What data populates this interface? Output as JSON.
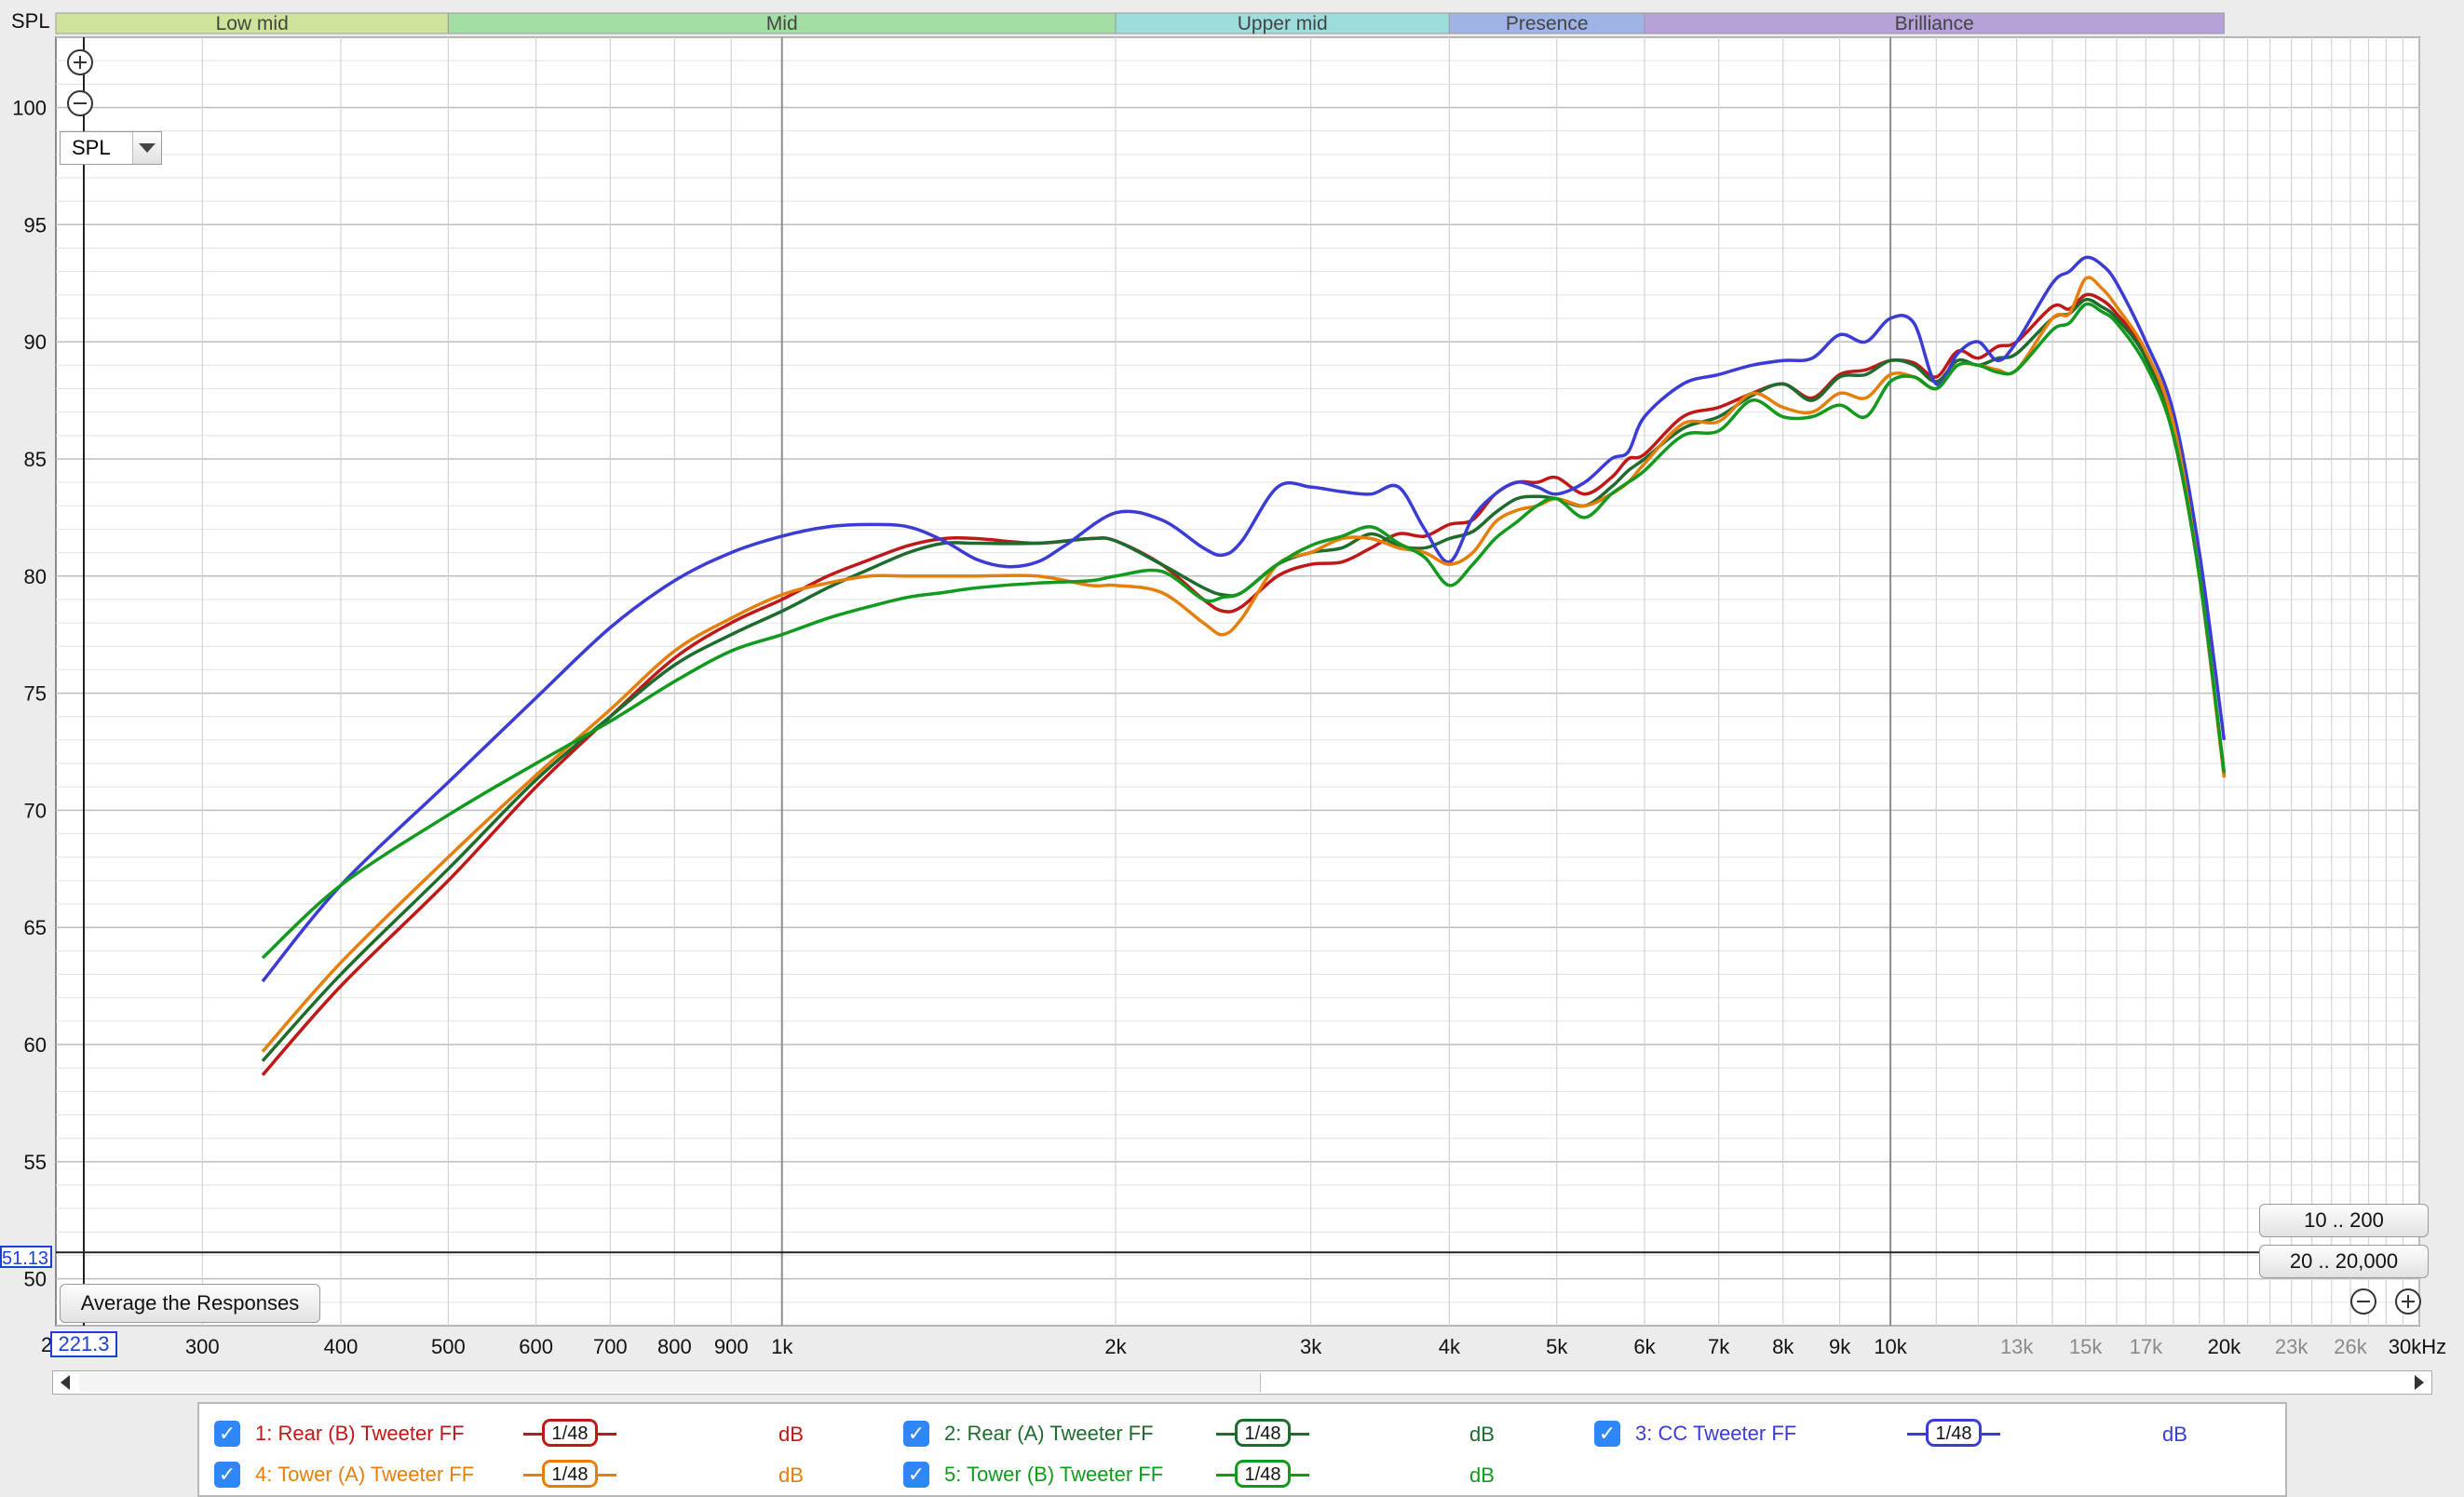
{
  "spl_title": "SPL",
  "unit_selector": "SPL",
  "y_cursor_value": "51.13",
  "x_cursor_value": "221.3",
  "x_axis_start": "2",
  "average_button": "Average the Responses",
  "range_buttons": [
    "10 .. 200",
    "20 .. 20,000"
  ],
  "bands": [
    {
      "label": "",
      "from": 20,
      "to": 100,
      "color": "#f7d08e"
    },
    {
      "label": "Low mid",
      "from": 100,
      "to": 500,
      "color": "#cfe39b"
    },
    {
      "label": "Mid",
      "from": 500,
      "to": 2000,
      "color": "#a3dea4"
    },
    {
      "label": "Upper mid",
      "from": 2000,
      "to": 4000,
      "color": "#9fdcdc"
    },
    {
      "label": "Presence",
      "from": 4000,
      "to": 6000,
      "color": "#9fb4e4"
    },
    {
      "label": "Brilliance",
      "from": 6000,
      "to": 20000,
      "color": "#b4a2d8"
    }
  ],
  "legend": [
    {
      "label": "1: Rear (B) Tweeter FF",
      "smoothing": "1/48",
      "unit": "dB",
      "color": "#c01818"
    },
    {
      "label": "2: Rear (A) Tweeter FF",
      "smoothing": "1/48",
      "unit": "dB",
      "color": "#1e6b2e"
    },
    {
      "label": "3: CC Tweeter FF",
      "smoothing": "1/48",
      "unit": "dB",
      "color": "#3b3bd6"
    },
    {
      "label": "4: Tower (A) Tweeter FF",
      "smoothing": "1/48",
      "unit": "dB",
      "color": "#e67e0c"
    },
    {
      "label": "5: Tower (B) Tweeter FF",
      "smoothing": "1/48",
      "unit": "dB",
      "color": "#119a1e"
    }
  ],
  "chart_data": {
    "type": "line",
    "xscale": "log",
    "xlabel": "Hz",
    "ylabel": "SPL",
    "xlim": [
      221.3,
      30000
    ],
    "ylim": [
      48,
      103
    ],
    "x_ticks": [
      {
        "v": 300,
        "label": "300"
      },
      {
        "v": 400,
        "label": "400"
      },
      {
        "v": 500,
        "label": "500"
      },
      {
        "v": 600,
        "label": "600"
      },
      {
        "v": 700,
        "label": "700"
      },
      {
        "v": 800,
        "label": "800"
      },
      {
        "v": 900,
        "label": "900"
      },
      {
        "v": 1000,
        "label": "1k"
      },
      {
        "v": 2000,
        "label": "2k"
      },
      {
        "v": 3000,
        "label": "3k"
      },
      {
        "v": 4000,
        "label": "4k"
      },
      {
        "v": 5000,
        "label": "5k"
      },
      {
        "v": 6000,
        "label": "6k"
      },
      {
        "v": 7000,
        "label": "7k"
      },
      {
        "v": 8000,
        "label": "8k"
      },
      {
        "v": 9000,
        "label": "9k"
      },
      {
        "v": 10000,
        "label": "10k"
      },
      {
        "v": 13000,
        "label": "13k",
        "muted": true
      },
      {
        "v": 15000,
        "label": "15k",
        "muted": true
      },
      {
        "v": 17000,
        "label": "17k",
        "muted": true
      },
      {
        "v": 20000,
        "label": "20k"
      },
      {
        "v": 23000,
        "label": "23k",
        "muted": true
      },
      {
        "v": 26000,
        "label": "26k",
        "muted": true
      },
      {
        "v": 30000,
        "label": "30kHz"
      }
    ],
    "y_ticks": [
      50,
      55,
      60,
      65,
      70,
      75,
      80,
      85,
      90,
      95,
      100
    ],
    "cursor": {
      "x": 221.3,
      "y": 51.13
    },
    "series": [
      {
        "name": "1: Rear (B) Tweeter FF",
        "color": "#c01818",
        "x": [
          340,
          400,
          500,
          600,
          700,
          800,
          900,
          1000,
          1100,
          1200,
          1300,
          1400,
          1500,
          1700,
          1900,
          2000,
          2200,
          2400,
          2500,
          2600,
          2800,
          3000,
          3200,
          3400,
          3600,
          3800,
          4000,
          4200,
          4400,
          4600,
          4800,
          5000,
          5300,
          5600,
          5800,
          6000,
          6500,
          7000,
          7500,
          8000,
          8500,
          9000,
          9500,
          10000,
          10500,
          11000,
          11500,
          12000,
          12500,
          13000,
          14000,
          14500,
          15000,
          15500,
          16000,
          17000,
          18000,
          19000,
          20000
        ],
        "y": [
          58.7,
          62.5,
          67,
          71,
          74,
          76.5,
          78,
          79,
          80,
          80.7,
          81.3,
          81.6,
          81.6,
          81.4,
          81.6,
          81.5,
          80.5,
          79,
          78.5,
          78.7,
          80,
          80.5,
          80.6,
          81.2,
          81.8,
          81.7,
          82.2,
          82.4,
          83.5,
          84,
          84,
          84.2,
          83.5,
          84.2,
          85,
          85.2,
          86.8,
          87.2,
          87.8,
          88.2,
          87.6,
          88.6,
          88.8,
          89.2,
          89.1,
          88.5,
          89.6,
          89.3,
          89.8,
          90,
          91.5,
          91.4,
          92,
          91.8,
          91.2,
          89.5,
          86,
          80,
          71.5
        ]
      },
      {
        "name": "2: Rear (A) Tweeter FF",
        "color": "#1e6b2e",
        "x": [
          340,
          400,
          500,
          600,
          700,
          800,
          900,
          1000,
          1100,
          1200,
          1300,
          1400,
          1500,
          1700,
          1900,
          2000,
          2200,
          2400,
          2500,
          2600,
          2800,
          3000,
          3200,
          3400,
          3600,
          3800,
          4000,
          4200,
          4400,
          4600,
          4800,
          5000,
          5300,
          5600,
          5800,
          6000,
          6500,
          7000,
          7500,
          8000,
          8500,
          9000,
          9500,
          10000,
          10500,
          11000,
          11500,
          12000,
          12500,
          13000,
          14000,
          14500,
          15000,
          15500,
          16000,
          17000,
          18000,
          19000,
          20000
        ],
        "y": [
          59.3,
          63,
          67.5,
          71.3,
          74,
          76.2,
          77.5,
          78.5,
          79.5,
          80.3,
          81,
          81.4,
          81.4,
          81.4,
          81.6,
          81.5,
          80.5,
          79.5,
          79.2,
          79.3,
          80.5,
          81,
          81.2,
          81.8,
          81.3,
          81.2,
          81.6,
          81.9,
          82.7,
          83.3,
          83.4,
          83.3,
          83,
          83.8,
          84.5,
          85,
          86.3,
          86.8,
          87.7,
          88.2,
          87.5,
          88.5,
          88.6,
          89.2,
          89,
          88.3,
          89.2,
          89,
          89.3,
          89.5,
          91,
          91.2,
          91.8,
          91.5,
          91,
          89.3,
          86,
          80,
          71.6
        ]
      },
      {
        "name": "3: CC Tweeter FF",
        "color": "#3b3bd6",
        "x": [
          340,
          400,
          500,
          600,
          700,
          800,
          900,
          1000,
          1100,
          1200,
          1300,
          1400,
          1500,
          1600,
          1700,
          1800,
          2000,
          2200,
          2400,
          2500,
          2600,
          2800,
          3000,
          3200,
          3400,
          3600,
          3800,
          4000,
          4200,
          4400,
          4600,
          4800,
          5000,
          5300,
          5600,
          5800,
          6000,
          6500,
          7000,
          7500,
          8000,
          8500,
          9000,
          9500,
          10000,
          10500,
          11000,
          11500,
          12000,
          12500,
          13000,
          14000,
          14500,
          15000,
          15500,
          16000,
          17000,
          18000,
          19000,
          20000
        ],
        "y": [
          62.7,
          66.8,
          71.2,
          74.8,
          77.8,
          79.8,
          81,
          81.7,
          82.1,
          82.2,
          82.1,
          81.5,
          80.7,
          80.4,
          80.6,
          81.3,
          82.7,
          82.4,
          81.2,
          80.9,
          81.5,
          83.8,
          83.8,
          83.6,
          83.5,
          83.8,
          82,
          80.6,
          82.5,
          83.5,
          84,
          83.8,
          83.5,
          84,
          85,
          85.3,
          86.8,
          88.2,
          88.6,
          89,
          89.2,
          89.3,
          90.3,
          90,
          91,
          90.8,
          88.2,
          89.5,
          90,
          89.2,
          90,
          92.5,
          93,
          93.6,
          93.3,
          92.5,
          90,
          87,
          81,
          73
        ]
      },
      {
        "name": "4: Tower (A) Tweeter FF",
        "color": "#e67e0c",
        "x": [
          340,
          400,
          500,
          600,
          700,
          800,
          900,
          1000,
          1100,
          1200,
          1300,
          1400,
          1500,
          1700,
          1900,
          2000,
          2200,
          2400,
          2500,
          2600,
          2800,
          3000,
          3200,
          3400,
          3600,
          3800,
          4000,
          4200,
          4400,
          4600,
          4800,
          5000,
          5300,
          5600,
          5800,
          6000,
          6500,
          7000,
          7500,
          8000,
          8500,
          9000,
          9500,
          10000,
          10500,
          11000,
          11500,
          12000,
          12500,
          13000,
          14000,
          14500,
          15000,
          15500,
          16000,
          17000,
          18000,
          19000,
          20000
        ],
        "y": [
          59.7,
          63.5,
          68,
          71.5,
          74.3,
          76.8,
          78.2,
          79.2,
          79.7,
          80,
          80,
          80,
          80,
          80,
          79.6,
          79.6,
          79.3,
          78,
          77.5,
          78.2,
          80.5,
          81,
          81.6,
          81.6,
          81.2,
          81,
          80.5,
          81,
          82.3,
          82.8,
          83,
          83.3,
          83,
          83.5,
          84,
          84.8,
          86.5,
          86.6,
          87.8,
          87.2,
          87,
          87.8,
          87.6,
          88.6,
          88.5,
          88,
          89,
          89,
          88.8,
          88.8,
          91,
          91.2,
          92.7,
          92.3,
          91.5,
          89.6,
          86.5,
          80,
          71.4
        ]
      },
      {
        "name": "5: Tower (B) Tweeter FF",
        "color": "#119a1e",
        "x": [
          340,
          400,
          500,
          600,
          700,
          800,
          900,
          1000,
          1100,
          1200,
          1300,
          1400,
          1500,
          1700,
          1900,
          2000,
          2200,
          2400,
          2500,
          2600,
          2800,
          3000,
          3200,
          3400,
          3600,
          3800,
          4000,
          4200,
          4400,
          4600,
          4800,
          5000,
          5300,
          5600,
          5800,
          6000,
          6500,
          7000,
          7500,
          8000,
          8500,
          9000,
          9500,
          10000,
          10500,
          11000,
          11500,
          12000,
          12500,
          13000,
          14000,
          14500,
          15000,
          15500,
          16000,
          17000,
          18000,
          19000,
          20000
        ],
        "y": [
          63.7,
          66.8,
          69.8,
          72,
          73.8,
          75.5,
          76.8,
          77.5,
          78.2,
          78.7,
          79.1,
          79.3,
          79.5,
          79.7,
          79.8,
          80,
          80.2,
          79,
          79.1,
          79.3,
          80.5,
          81.3,
          81.7,
          82.1,
          81.4,
          80.8,
          79.6,
          80.5,
          81.6,
          82.3,
          83,
          83.3,
          82.5,
          83.5,
          84,
          84.5,
          86,
          86.2,
          87.5,
          86.8,
          86.8,
          87.3,
          86.8,
          88.3,
          88.5,
          88,
          89,
          89,
          88.7,
          88.8,
          90.5,
          90.8,
          91.6,
          91.3,
          90.8,
          89,
          86,
          80,
          71.6
        ]
      }
    ]
  }
}
